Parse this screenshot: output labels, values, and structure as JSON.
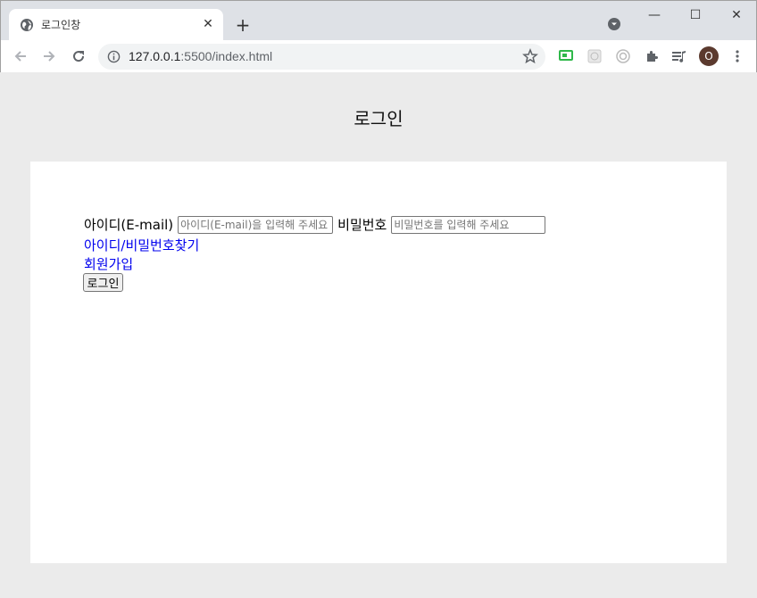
{
  "browser": {
    "tab_title": "로그인창",
    "url_host": "127.0.0.1",
    "url_path": ":5500/index.html",
    "avatar_letter": "O"
  },
  "page": {
    "heading": "로그인",
    "id_label": "아이디(E-mail)",
    "id_placeholder": "아이디(E-mail)을 입력해 주세요",
    "pw_label": "비밀번호",
    "pw_placeholder": "비밀번호를 입력해 주세요",
    "find_link": "아이디/비밀번호찾기",
    "join_link": "회원가입",
    "login_button": "로그인"
  }
}
